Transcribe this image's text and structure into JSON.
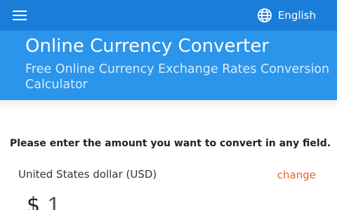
{
  "header": {
    "menu_icon": "hamburger-menu-icon",
    "language_icon": "globe-icon",
    "language_label": "English"
  },
  "hero": {
    "title": "Online Currency Converter",
    "subtitle": "Free Online Currency Exchange Rates Conversion Calculator"
  },
  "converter": {
    "instruction": "Please enter the amount you want to convert in any field.",
    "currency_name": "United States dollar (USD)",
    "change_label": "change",
    "currency_symbol": "$",
    "amount_value": "1"
  },
  "colors": {
    "topbar": "#1a7ed8",
    "hero": "#2b95ec",
    "link": "#e8622f"
  }
}
